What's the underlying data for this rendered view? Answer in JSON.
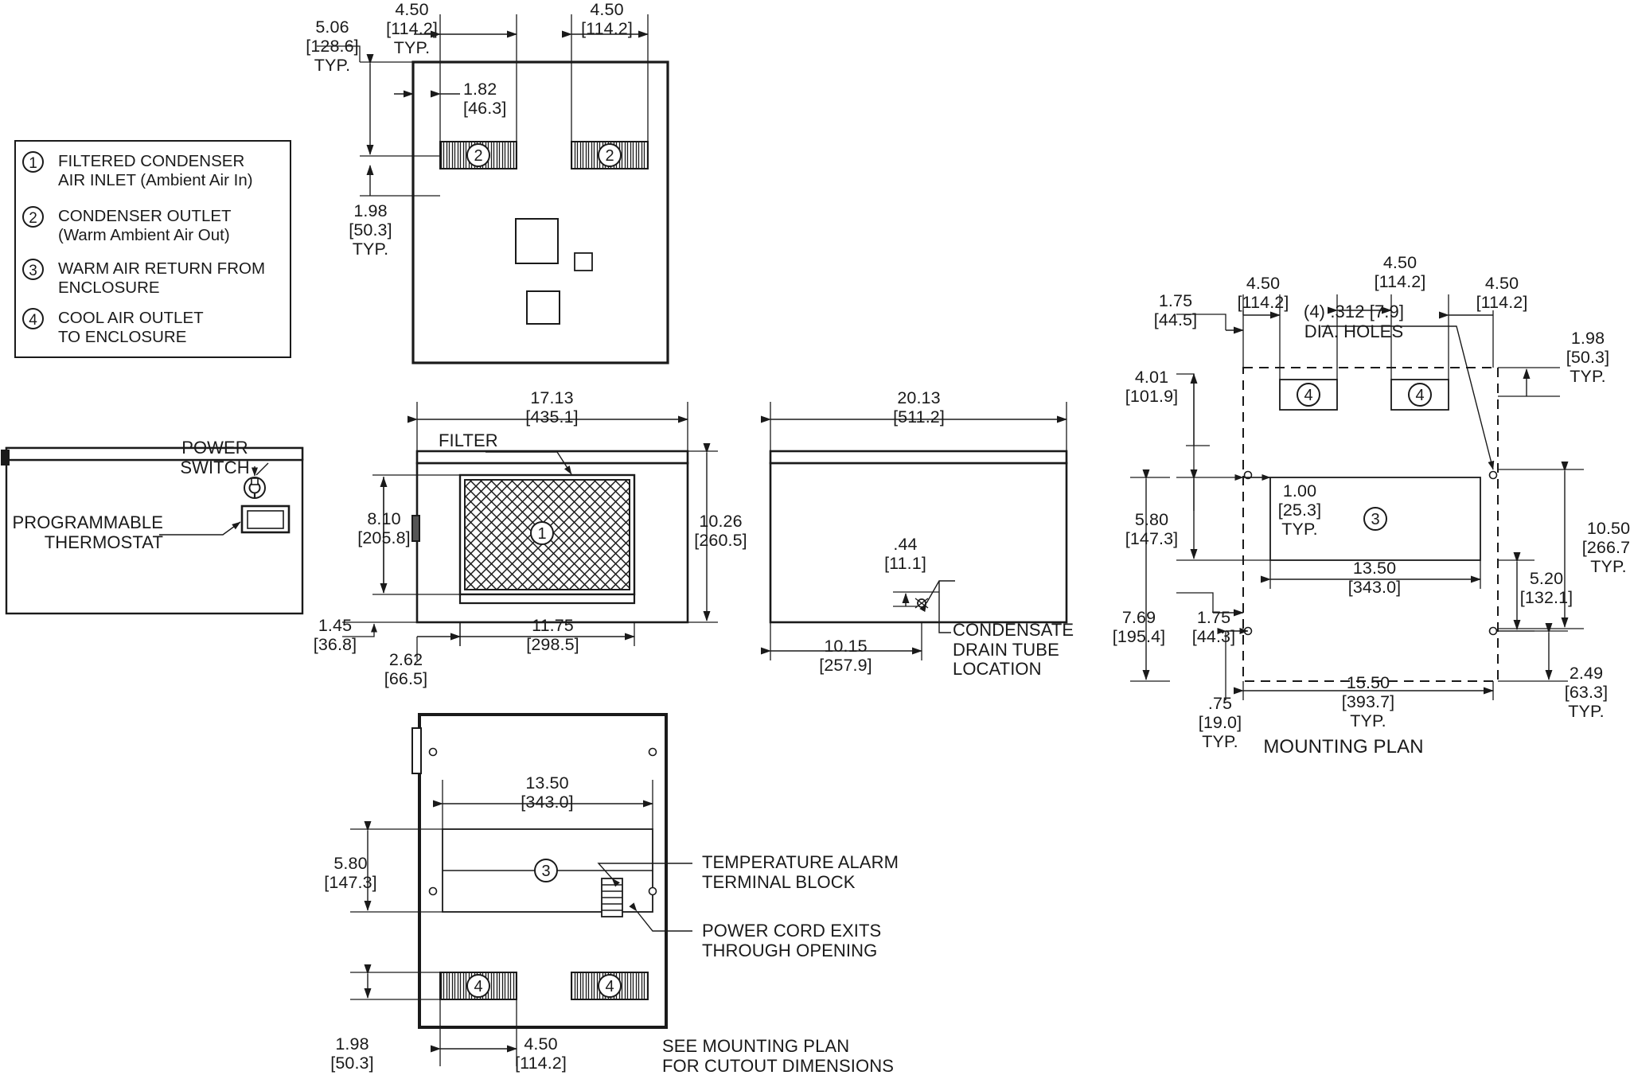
{
  "legend": {
    "items": [
      {
        "num": "1",
        "line1": "FILTERED CONDENSER",
        "line2": "AIR INLET (Ambient Air In)"
      },
      {
        "num": "2",
        "line1": "CONDENSER OUTLET",
        "line2": "(Warm Ambient Air Out)"
      },
      {
        "num": "3",
        "line1": "WARM AIR RETURN FROM",
        "line2": "ENCLOSURE"
      },
      {
        "num": "4",
        "line1": "COOL AIR OUTLET",
        "line2": "TO ENCLOSURE"
      }
    ]
  },
  "top_view": {
    "dim_506": "5.06\n[128.6]\nTYP.",
    "dim_450_left": "4.50\n[114.2]\nTYP.",
    "dim_450_right": "4.50\n[114.2]",
    "dim_182": "1.82\n[46.3]",
    "dim_198": "1.98\n[50.3]\nTYP.",
    "balloon_a": "2",
    "balloon_b": "2"
  },
  "left_view": {
    "label_power_switch": "POWER\nSWITCH",
    "label_thermostat": "PROGRAMMABLE\nTHERMOSTAT"
  },
  "front_view": {
    "dim_width": "17.13\n[435.1]",
    "label_filter": "FILTER",
    "dim_810": "8.10\n[205.8]",
    "dim_1026": "10.26\n[260.5]",
    "dim_145": "1.45\n[36.8]",
    "dim_262": "2.62\n[66.5]",
    "dim_1175": "11.75\n[298.5]",
    "balloon_filter": "1"
  },
  "side_view": {
    "dim_depth": "20.13\n[511.2]",
    "dim_44": ".44\n[11.1]",
    "dim_1015": "10.15\n[257.9]",
    "label_condensate": "CONDENSATE\nDRAIN TUBE\nLOCATION"
  },
  "bottom_view": {
    "dim_1350": "13.50\n[343.0]",
    "dim_580": "5.80\n[147.3]",
    "dim_198": "1.98\n[50.3]",
    "dim_450": "4.50\n[114.2]",
    "label_alarm": "TEMPERATURE ALARM\nTERMINAL BLOCK",
    "label_cord": "POWER CORD EXITS\nTHROUGH OPENING",
    "label_see_mounting": "SEE MOUNTING PLAN\nFOR CUTOUT DIMENSIONS",
    "balloon_3": "3",
    "balloon_4a": "4",
    "balloon_4b": "4"
  },
  "mounting_plan": {
    "title": "MOUNTING PLAN",
    "dim_175_top": "1.75\n[44.5]",
    "dim_450_a": "4.50\n[114.2]",
    "dim_450_b": "4.50\n[114.2]",
    "dim_450_c": "4.50\n[114.2]",
    "dim_198": "1.98\n[50.3]\nTYP.",
    "dim_401": "4.01\n[101.9]",
    "dim_580": "5.80\n[147.3]",
    "dim_100": "1.00\n[25.3]\nTYP.",
    "dim_1050": "10.50\n[266.7]\nTYP.",
    "dim_1350": "13.50\n[343.0]",
    "dim_520": "5.20\n[132.1]",
    "dim_769": "7.69\n[195.4]",
    "dim_175_bot": "1.75\n[44.3]",
    "dim_1550": "15.50\n[393.7]\nTYP.",
    "dim_075": ".75\n[19.0]\nTYP.",
    "dim_249": "2.49\n[63.3]\nTYP.",
    "label_holes": "(4) .312 [7.9]\nDIA. HOLES",
    "balloon_4a": "4",
    "balloon_4b": "4",
    "balloon_3": "3"
  },
  "colors": {
    "line": "#1a1a1a",
    "background": "#ffffff"
  }
}
